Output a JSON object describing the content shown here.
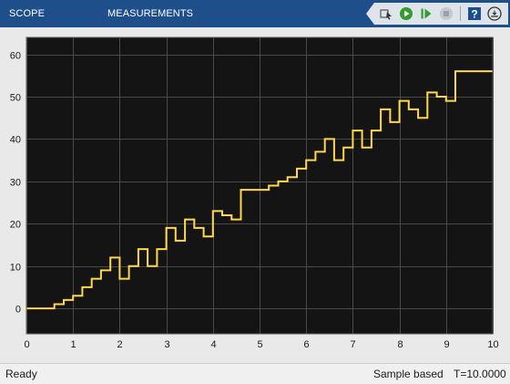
{
  "toolstrip": {
    "tabs": [
      {
        "label": "SCOPE"
      },
      {
        "label": "MEASUREMENTS"
      }
    ],
    "tools": [
      {
        "icon": "highlight-simulink-block-icon"
      },
      {
        "icon": "run-icon"
      },
      {
        "icon": "step-forward-icon"
      },
      {
        "icon": "stop-icon"
      },
      {
        "icon": "help-icon"
      },
      {
        "icon": "undock-icon"
      }
    ]
  },
  "colors": {
    "toolstrip_bg": "#1f4f8a",
    "plot_bg": "#141414",
    "grid": "#4a4a4a",
    "trace": "#ffd84a",
    "run_green": "#2f9e2f"
  },
  "chart_data": {
    "type": "line",
    "step": true,
    "title": "",
    "xlabel": "",
    "ylabel": "",
    "xlim": [
      0,
      10
    ],
    "ylim": [
      -6,
      64
    ],
    "xticks": [
      0,
      1,
      2,
      3,
      4,
      5,
      6,
      7,
      8,
      9,
      10
    ],
    "yticks": [
      0,
      10,
      20,
      30,
      40,
      50,
      60
    ],
    "grid": true,
    "series": [
      {
        "color": "#ffd84a",
        "x": [
          0,
          0.6,
          0.8,
          1.0,
          1.2,
          1.4,
          1.6,
          1.8,
          2.0,
          2.2,
          2.4,
          2.6,
          2.8,
          3.0,
          3.2,
          3.4,
          3.6,
          3.8,
          4.0,
          4.2,
          4.4,
          4.6,
          5.0,
          5.2,
          5.4,
          5.6,
          5.8,
          6.0,
          6.2,
          6.4,
          6.6,
          6.8,
          7.0,
          7.2,
          7.4,
          7.6,
          7.8,
          8.0,
          8.2,
          8.4,
          8.6,
          8.8,
          9.0,
          9.2,
          9.4,
          10.0
        ],
        "y": [
          0,
          1,
          2,
          3,
          5,
          7,
          9,
          12,
          7,
          10,
          14,
          10,
          14,
          19,
          16,
          21,
          19,
          17,
          23,
          22,
          21,
          28,
          28,
          29,
          30,
          31,
          33,
          35,
          37,
          40,
          35,
          38,
          42,
          38,
          42,
          47,
          44,
          49,
          47,
          45,
          51,
          50,
          49,
          56,
          56,
          56
        ]
      }
    ]
  },
  "status": {
    "left": "Ready",
    "mode": "Sample based",
    "time": "T=10.0000"
  }
}
